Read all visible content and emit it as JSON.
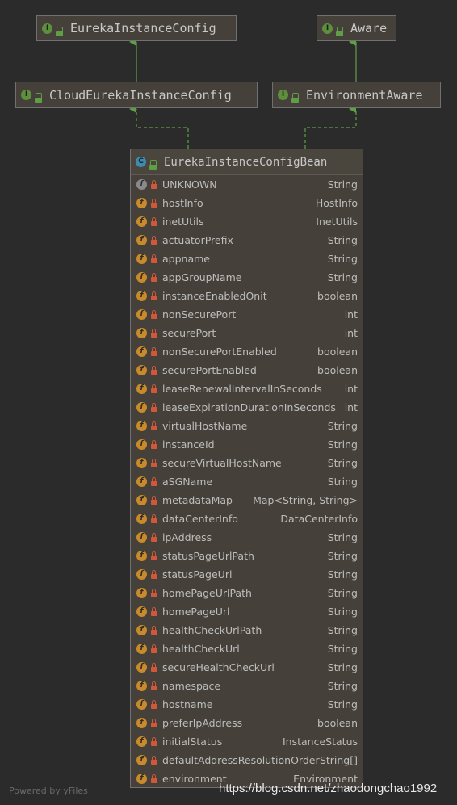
{
  "nodes": {
    "eureka_instance_config": {
      "label": "EurekaInstanceConfig",
      "kind": "interface"
    },
    "aware": {
      "label": "Aware",
      "kind": "interface"
    },
    "cloud_eureka_instance_config": {
      "label": "CloudEurekaInstanceConfig",
      "kind": "interface"
    },
    "environment_aware": {
      "label": "EnvironmentAware",
      "kind": "interface"
    },
    "eureka_instance_config_bean": {
      "label": "EurekaInstanceConfigBean",
      "kind": "class"
    }
  },
  "icons": {
    "interface": "I",
    "class": "C",
    "field": "f"
  },
  "edges": [
    {
      "from": "cloud_eureka_instance_config",
      "to": "eureka_instance_config",
      "style": "solid"
    },
    {
      "from": "environment_aware",
      "to": "aware",
      "style": "solid"
    },
    {
      "from": "eureka_instance_config_bean",
      "to": "cloud_eureka_instance_config",
      "style": "dashed"
    },
    {
      "from": "eureka_instance_config_bean",
      "to": "environment_aware",
      "style": "dashed"
    }
  ],
  "fields": [
    {
      "name": "UNKNOWN",
      "type": "String"
    },
    {
      "name": "hostInfo",
      "type": "HostInfo"
    },
    {
      "name": "inetUtils",
      "type": "InetUtils"
    },
    {
      "name": "actuatorPrefix",
      "type": "String"
    },
    {
      "name": "appname",
      "type": "String"
    },
    {
      "name": "appGroupName",
      "type": "String"
    },
    {
      "name": "instanceEnabledOnit",
      "type": "boolean"
    },
    {
      "name": "nonSecurePort",
      "type": "int"
    },
    {
      "name": "securePort",
      "type": "int"
    },
    {
      "name": "nonSecurePortEnabled",
      "type": "boolean"
    },
    {
      "name": "securePortEnabled",
      "type": "boolean"
    },
    {
      "name": "leaseRenewalIntervalInSeconds",
      "type": "int"
    },
    {
      "name": "leaseExpirationDurationInSeconds",
      "type": "int"
    },
    {
      "name": "virtualHostName",
      "type": "String"
    },
    {
      "name": "instanceId",
      "type": "String"
    },
    {
      "name": "secureVirtualHostName",
      "type": "String"
    },
    {
      "name": "aSGName",
      "type": "String"
    },
    {
      "name": "metadataMap",
      "type": "Map<String, String>"
    },
    {
      "name": "dataCenterInfo",
      "type": "DataCenterInfo"
    },
    {
      "name": "ipAddress",
      "type": "String"
    },
    {
      "name": "statusPageUrlPath",
      "type": "String"
    },
    {
      "name": "statusPageUrl",
      "type": "String"
    },
    {
      "name": "homePageUrlPath",
      "type": "String"
    },
    {
      "name": "homePageUrl",
      "type": "String"
    },
    {
      "name": "healthCheckUrlPath",
      "type": "String"
    },
    {
      "name": "healthCheckUrl",
      "type": "String"
    },
    {
      "name": "secureHealthCheckUrl",
      "type": "String"
    },
    {
      "name": "namespace",
      "type": "String"
    },
    {
      "name": "hostname",
      "type": "String"
    },
    {
      "name": "preferIpAddress",
      "type": "boolean"
    },
    {
      "name": "initialStatus",
      "type": "InstanceStatus"
    },
    {
      "name": "defaultAddressResolutionOrder",
      "type": "String[]"
    },
    {
      "name": "environment",
      "type": "Environment"
    }
  ],
  "footer": {
    "powered_by": "Powered by yFiles",
    "watermark": "https://blog.csdn.net/zhaodongchao1992"
  },
  "colors": {
    "background": "#2b2b2b",
    "node_fill": "#45413a",
    "edge": "#5e9f46",
    "interface_icon": "#5e8f3c",
    "class_icon": "#3d8cb0",
    "field_icon": "#c88a2a",
    "lock_icon": "#d0583a"
  }
}
